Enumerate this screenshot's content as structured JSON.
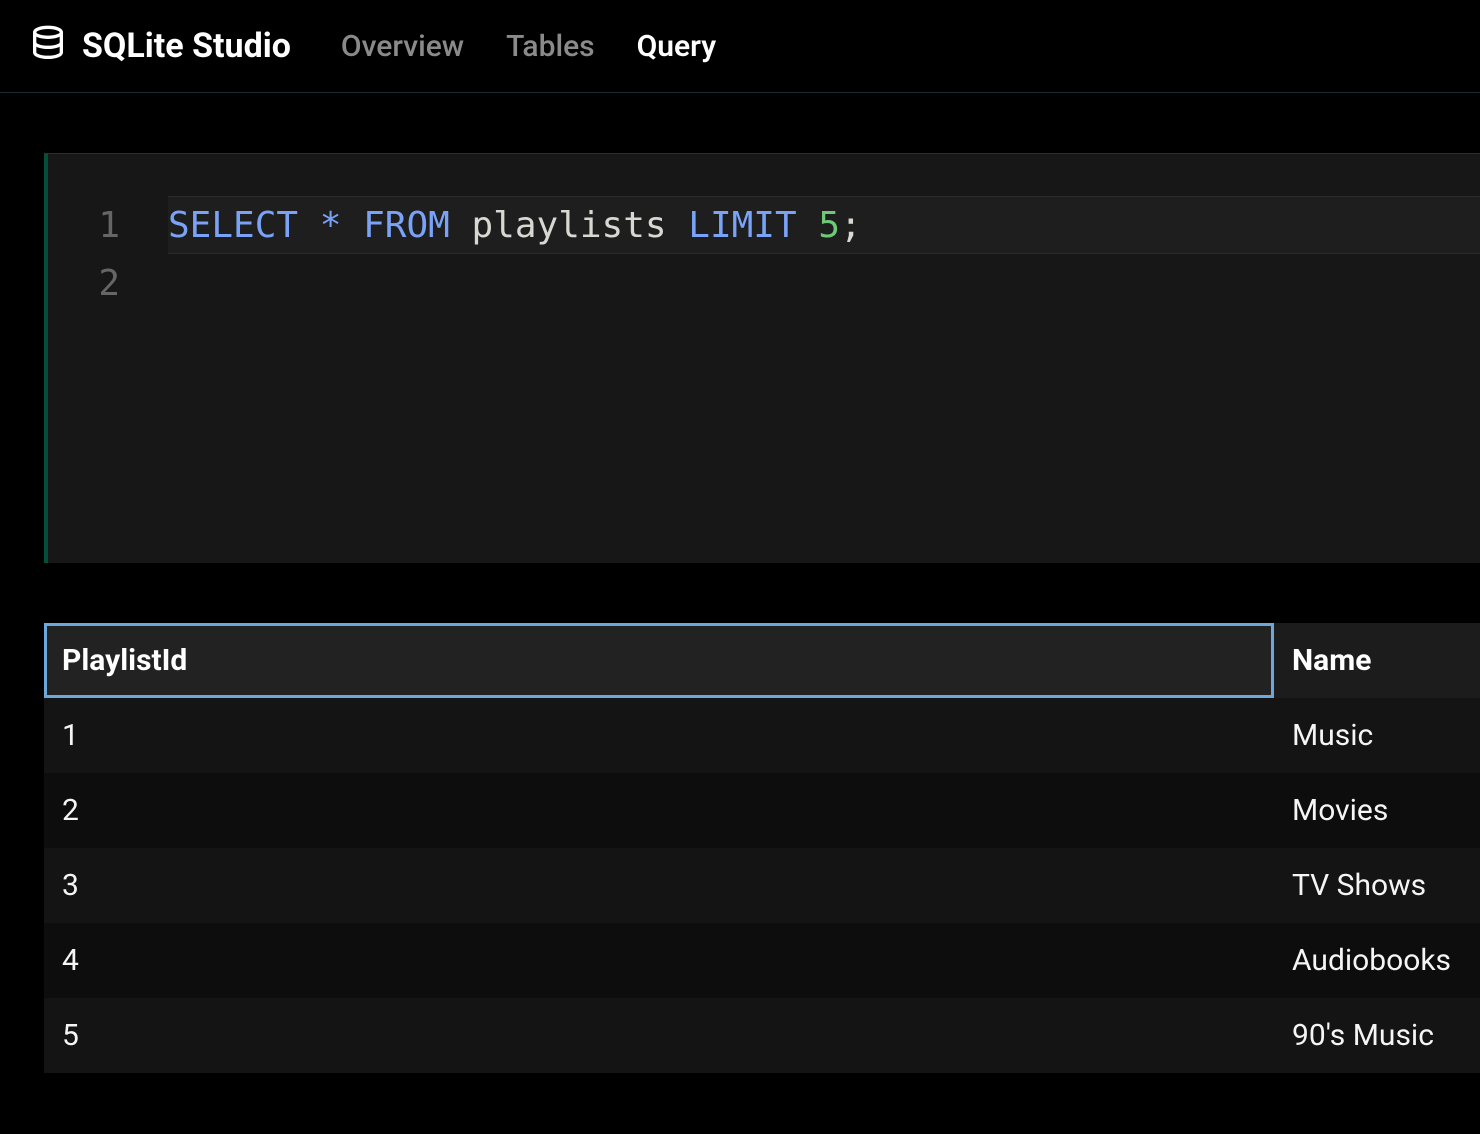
{
  "app": {
    "title": "SQLite Studio"
  },
  "nav": {
    "items": [
      {
        "label": "Overview",
        "active": false
      },
      {
        "label": "Tables",
        "active": false
      },
      {
        "label": "Query",
        "active": true
      }
    ]
  },
  "editor": {
    "lines": [
      {
        "num": "1",
        "tokens": [
          {
            "t": "SELECT",
            "c": "kw"
          },
          {
            "t": " ",
            "c": "sp"
          },
          {
            "t": "*",
            "c": "op"
          },
          {
            "t": " ",
            "c": "sp"
          },
          {
            "t": "FROM",
            "c": "kw"
          },
          {
            "t": " ",
            "c": "sp"
          },
          {
            "t": "playlists",
            "c": "ident"
          },
          {
            "t": " ",
            "c": "sp"
          },
          {
            "t": "LIMIT",
            "c": "kw"
          },
          {
            "t": " ",
            "c": "sp"
          },
          {
            "t": "5",
            "c": "num"
          },
          {
            "t": ";",
            "c": "punc"
          }
        ],
        "current": true
      },
      {
        "num": "2",
        "tokens": [],
        "current": false
      }
    ]
  },
  "results": {
    "columns": [
      {
        "label": "PlaylistId",
        "selected": true
      },
      {
        "label": "Name",
        "selected": false
      }
    ],
    "rows": [
      {
        "PlaylistId": "1",
        "Name": "Music"
      },
      {
        "PlaylistId": "2",
        "Name": "Movies"
      },
      {
        "PlaylistId": "3",
        "Name": "TV Shows"
      },
      {
        "PlaylistId": "4",
        "Name": "Audiobooks"
      },
      {
        "PlaylistId": "5",
        "Name": "90's Music"
      }
    ]
  }
}
